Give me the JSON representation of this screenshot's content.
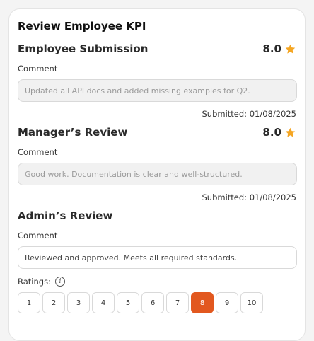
{
  "modal": {
    "title": "Review Employee KPI"
  },
  "employee_submission": {
    "title": "Employee Submission",
    "score": "8.0",
    "comment_label": "Comment",
    "comment_text": "Updated all API docs and added missing examples for Q2.",
    "submitted": "Submitted: 01/08/2025"
  },
  "manager_review": {
    "title": "Manager’s Review",
    "score": "8.0",
    "comment_label": "Comment",
    "comment_text": "Good work. Documentation is clear and well-structured.",
    "submitted": "Submitted: 01/08/2025"
  },
  "admin_review": {
    "title": "Admin’s Review",
    "comment_label": "Comment",
    "comment_value": "Reviewed and approved. Meets all required standards.",
    "ratings_label": "Ratings:",
    "ratings": [
      "1",
      "2",
      "3",
      "4",
      "5",
      "6",
      "7",
      "8",
      "9",
      "10"
    ],
    "selected_rating": "8"
  },
  "colors": {
    "accent": "#e2581f",
    "star": "#f5a623"
  },
  "icons": {
    "score": "star-icon",
    "info": "info-icon"
  }
}
